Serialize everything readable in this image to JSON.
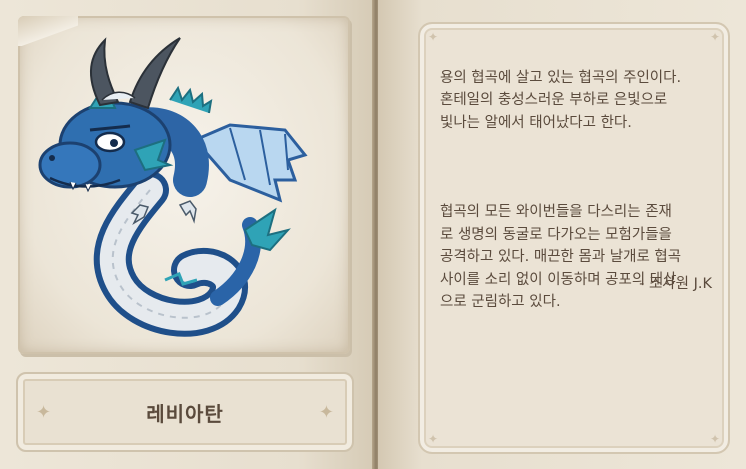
{
  "monster": {
    "name": "레비아탄",
    "portrait_icon": "blue-dragon-leviathan"
  },
  "description": {
    "paragraph1": "용의 협곡에 살고 있는 협곡의 주인이다.\n혼테일의 충성스러운 부하로 은빛으로\n빛나는 알에서 태어났다고 한다.",
    "paragraph2": "협곡의 모든 와이번들을 다스리는 존재\n로 생명의 동굴로 다가오는 모험가들을\n공격하고 있다. 매끈한 몸과 날개로 협곡\n사이를 소리 없이 이동하며 공포의 대상\n으로 군림하고 있다.",
    "signature": "- 조사원 J.K"
  },
  "colors": {
    "page": "#ede6d8",
    "text": "#5b4b3d",
    "dragon_blue": "#2f6fb0",
    "dragon_teal": "#2f9fb3"
  }
}
